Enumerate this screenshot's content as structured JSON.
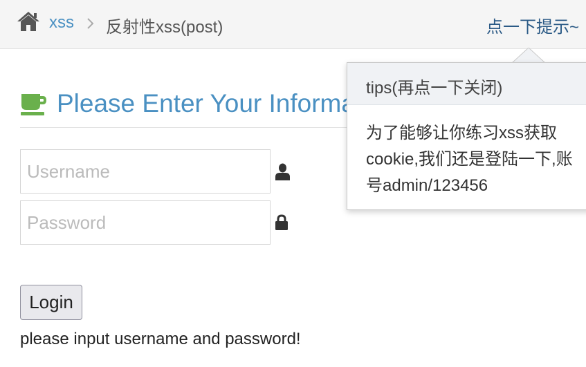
{
  "breadcrumb": {
    "home_icon": "home-icon",
    "link_label": "xss",
    "separator_icon": "chevron-right-icon",
    "current_label": "反射性xss(post)"
  },
  "hint_link": "点一下提示~",
  "header": {
    "icon": "coffee-cup-icon",
    "title": "Please Enter Your Information"
  },
  "form": {
    "username_placeholder": "Username",
    "username_value": "",
    "username_icon": "user-icon",
    "password_placeholder": "Password",
    "password_value": "",
    "password_icon": "lock-icon",
    "login_label": "Login",
    "status_message": "please input username and password!"
  },
  "popover": {
    "title": "tips(再点一下关闭)",
    "body": "为了能够让你练习xss获取cookie,我们还是登陆一下,账号admin/123456"
  },
  "colors": {
    "accent_blue": "#4a90c2",
    "dark_link": "#2b5a86",
    "cup_green": "#6ab04c",
    "topbar_bg": "#f5f5f5"
  }
}
